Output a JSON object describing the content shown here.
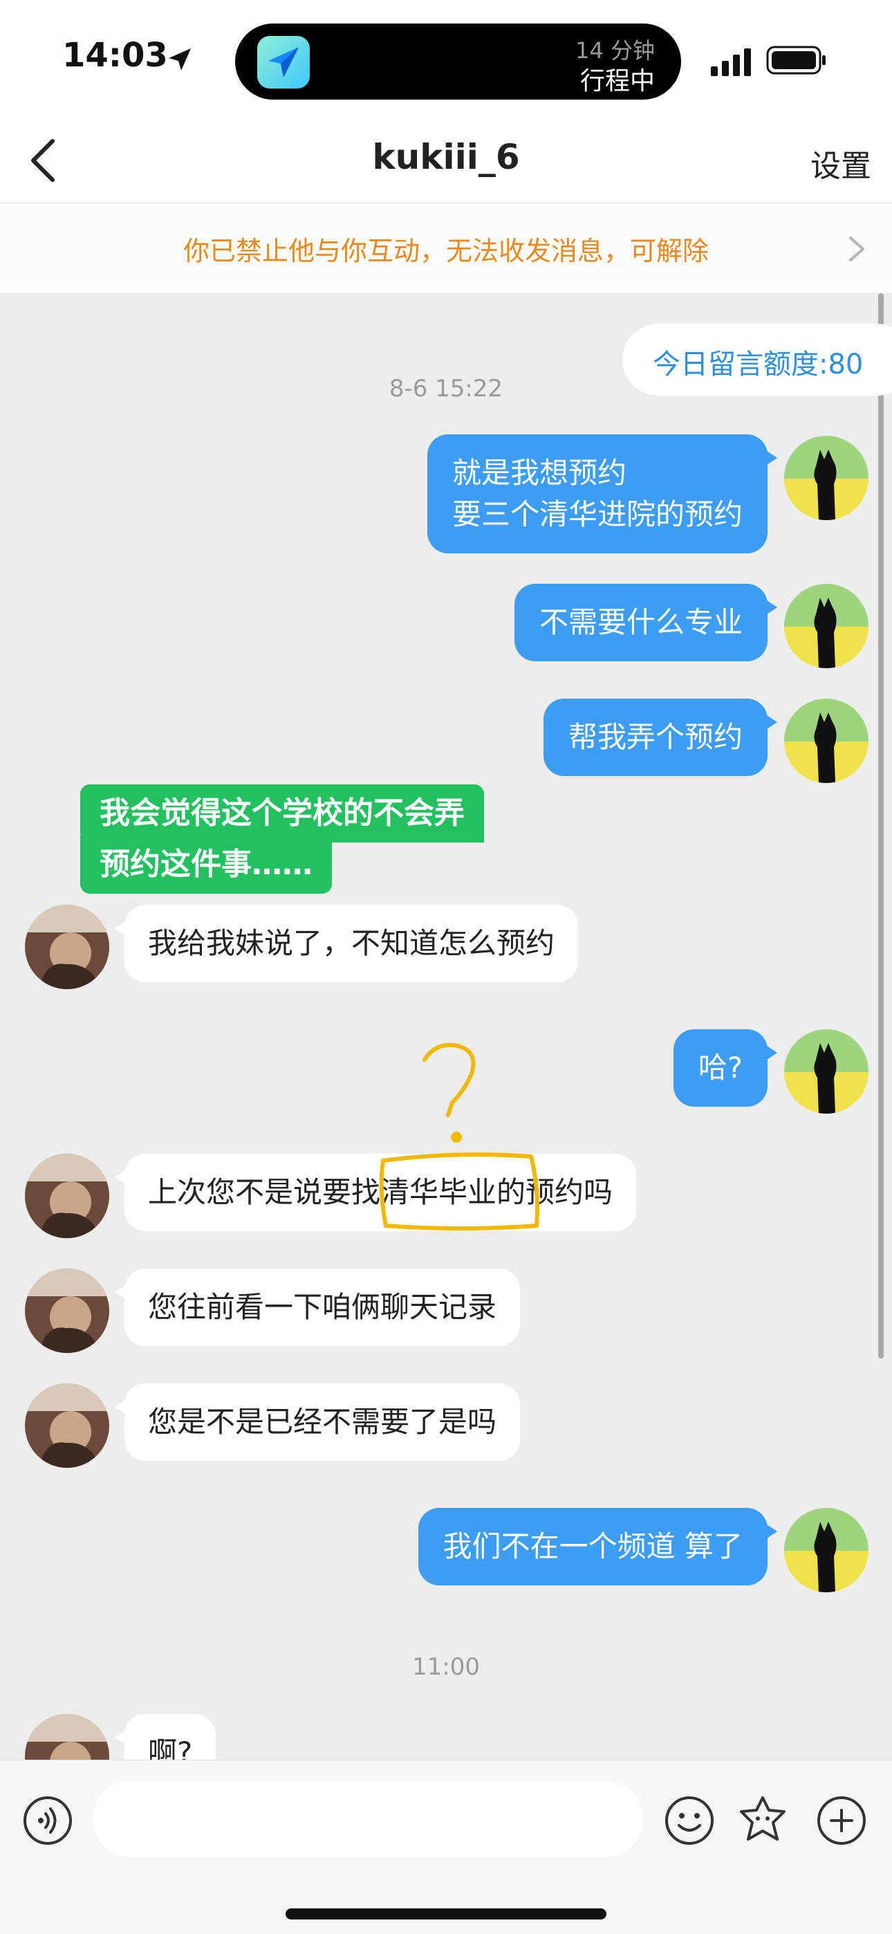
{
  "status_bar": {
    "time": "14:03",
    "island_sub": "14 分钟",
    "island_main": "行程中"
  },
  "header": {
    "title": "kukiii_6",
    "settings_label": "设置"
  },
  "notice": {
    "text": "你已禁止他与你互动，无法收发消息，可解除"
  },
  "chat": {
    "quota_label": "今日留言额度:80",
    "timestamp_1": "8-6 15:22",
    "timestamp_2": "11:00",
    "messages": [
      {
        "side": "mine",
        "lines": [
          "就是我想预约",
          "要三个清华进院的预约"
        ]
      },
      {
        "side": "mine",
        "lines": [
          "不需要什么专业"
        ]
      },
      {
        "side": "mine",
        "lines": [
          "帮我弄个预约"
        ]
      },
      {
        "side": "theirs",
        "lines": [
          "我给我妹说了，不知道怎么预约"
        ]
      },
      {
        "side": "mine",
        "lines": [
          "哈?"
        ]
      },
      {
        "side": "theirs",
        "lines": [
          "上次您不是说要找清华毕业的预约吗"
        ]
      },
      {
        "side": "theirs",
        "lines": [
          "您往前看一下咱俩聊天记录"
        ]
      },
      {
        "side": "theirs",
        "lines": [
          "您是不是已经不需要了是吗"
        ]
      },
      {
        "side": "mine",
        "lines": [
          "我们不在一个频道 算了"
        ]
      },
      {
        "side": "theirs",
        "lines": [
          "啊?"
        ]
      }
    ],
    "caption_lines": [
      "我会觉得这个学校的不会弄",
      "预约这件事……"
    ],
    "annotation_mark": "?",
    "accent_colors": {
      "mine_bubble": "#3d9cf3",
      "notice_text": "#e9891e",
      "caption": "#23c05f",
      "annotation": "#f5b800"
    }
  },
  "input_bar": {
    "icons": [
      "voice-icon",
      "emoji-icon",
      "sticker-icon",
      "plus-icon"
    ]
  }
}
